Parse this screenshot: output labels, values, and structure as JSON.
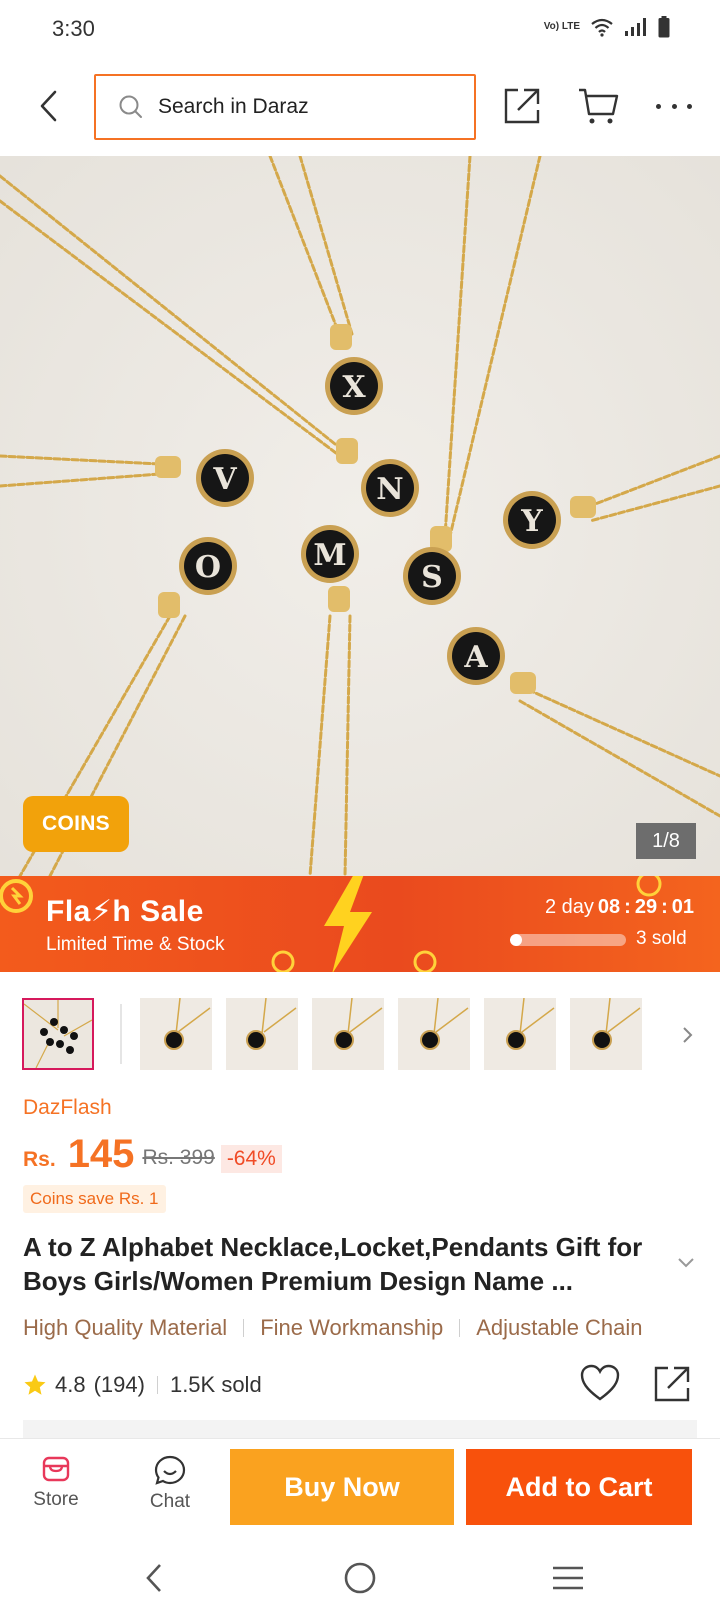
{
  "status_bar": {
    "time": "3:30",
    "network_label": "Vo) LTE"
  },
  "header": {
    "search_placeholder": "Search in Daraz",
    "icons": [
      "back-icon",
      "search-icon",
      "share-icon",
      "cart-icon",
      "more-icon"
    ]
  },
  "gallery": {
    "coins_badge": "COINS",
    "counter": "1/8",
    "pendant_letters": [
      "X",
      "N",
      "V",
      "Y",
      "O",
      "M",
      "S",
      "A"
    ]
  },
  "flash_sale": {
    "title": "Fla⚡h Sale",
    "subtitle": "Limited Time & Stock",
    "days_label": "2 day",
    "hours": "08",
    "minutes": "29",
    "seconds": "01",
    "sold_text": "3 sold",
    "sold_progress": 0.1
  },
  "thumbnails": {
    "count": 7
  },
  "product": {
    "brand": "DazFlash",
    "currency": "Rs.",
    "price": "145",
    "original_price": "Rs. 399",
    "discount": "-64%",
    "coins_save": "Coins save Rs. 1",
    "title": "A to Z Alphabet Necklace,Locket,Pendants Gift for Boys Girls/Women Premium Design Name ...",
    "features": [
      "High Quality Material",
      "Fine Workmanship",
      "Adjustable Chain"
    ],
    "rating": "4.8",
    "rating_count": "(194)",
    "sold": "1.5K sold"
  },
  "action_bar": {
    "store_label": "Store",
    "chat_label": "Chat",
    "buy_now_label": "Buy Now",
    "add_to_cart_label": "Add to Cart"
  },
  "colors": {
    "accent": "#f57224",
    "buy_now": "#faa21f",
    "add_to_cart": "#f8510c",
    "flash_bg": "#ea4a1e",
    "coins_badge": "#f2a20b"
  }
}
